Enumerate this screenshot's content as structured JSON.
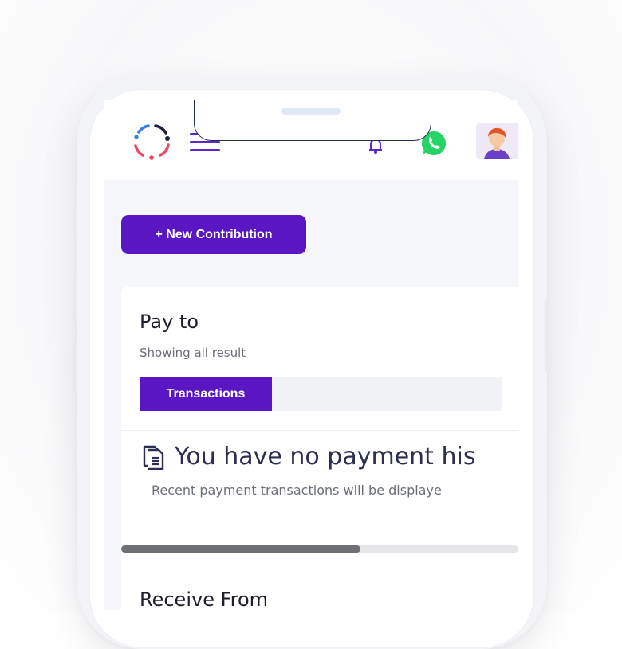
{
  "header": {
    "logo_icon": "circular-dots-logo",
    "menu_icon": "hamburger-menu-icon",
    "notification_icon": "bell-icon",
    "whatsapp_icon": "whatsapp-icon",
    "avatar_icon": "user-avatar"
  },
  "actions": {
    "new_contribution_label": "+ New Contribution"
  },
  "pay_to": {
    "title": "Pay to",
    "subtitle": "Showing all result",
    "tabs": [
      {
        "label": "Transactions",
        "active": true
      }
    ],
    "empty_state": {
      "icon": "document-icon",
      "title": "You have no payment his",
      "message": "Recent payment transactions will be displaye"
    },
    "scroll_position": 0.6
  },
  "receive_from": {
    "title": "Receive From"
  },
  "colors": {
    "accent": "#5b16c4",
    "title_text": "#2b2f52",
    "whatsapp": "#25d366"
  }
}
